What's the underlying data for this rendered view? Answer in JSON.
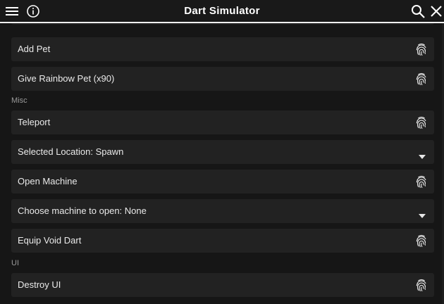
{
  "window": {
    "title": "Dart Simulator",
    "icons": {
      "left": [
        "menu-icon",
        "info-icon"
      ],
      "right": [
        "search-icon",
        "close-icon"
      ]
    }
  },
  "colors": {
    "background": "#161616",
    "item": "#222222",
    "accent": "#ffffff",
    "section": "#9a9a9a"
  },
  "items_top": [
    {
      "label": "Add Pet",
      "icon": "fingerprint-icon"
    },
    {
      "label": "Give Rainbow Pet (x90)",
      "icon": "fingerprint-icon"
    }
  ],
  "sections": [
    {
      "title": "Misc",
      "items": [
        {
          "label": "Teleport",
          "icon": "fingerprint-icon"
        },
        {
          "label": "Selected Location: Spawn",
          "icon": "dropdown-arrow-icon"
        },
        {
          "label": "Open Machine",
          "icon": "fingerprint-icon"
        },
        {
          "label": "Choose machine to open: None",
          "icon": "dropdown-arrow-icon"
        },
        {
          "label": "Equip Void Dart",
          "icon": "fingerprint-icon"
        }
      ]
    },
    {
      "title": "UI",
      "items": [
        {
          "label": "Destroy UI",
          "icon": "fingerprint-icon"
        }
      ]
    }
  ]
}
